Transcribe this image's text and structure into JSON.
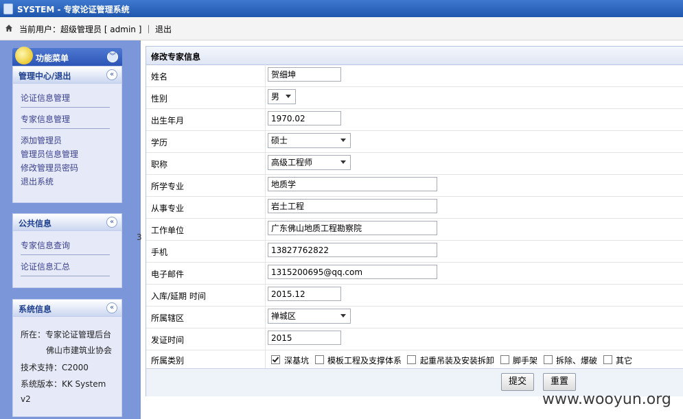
{
  "app": {
    "title": "SYSTEM - 专家论证管理系统"
  },
  "userbar": {
    "text": "当前用户：超级管理员 [ admin ] ｜ 退出"
  },
  "sidebar": {
    "menu_title": "功能菜单",
    "panel1": {
      "title": "管理中心/退出",
      "items": [
        "论证信息管理",
        "专家信息管理",
        "添加管理员",
        "管理员信息管理",
        "修改管理员密码",
        "退出系统"
      ]
    },
    "panel2": {
      "title": "公共信息",
      "items": [
        "专家信息查询",
        "论证信息汇总"
      ]
    },
    "panel3": {
      "title": "系统信息",
      "lines": [
        "所在：专家论证管理后台",
        "佛山市建筑业协会",
        "技术支持：C2000",
        "系统版本：KK System",
        "v2"
      ]
    }
  },
  "stray_char": "3",
  "form": {
    "title": "修改专家信息",
    "labels": [
      "姓名",
      "性别",
      "出生年月",
      "学历",
      "职称",
      "所学专业",
      "从事专业",
      "工作单位",
      "手机",
      "电子邮件",
      "入库/延期 时间",
      "所属辖区",
      "发证时间",
      "所属类别"
    ],
    "values": {
      "name": "贺细坤",
      "gender": "男",
      "birth": "1970.02",
      "education": "硕士",
      "title": "高级工程师",
      "major": "地质学",
      "profession": "岩土工程",
      "company": "广东佛山地质工程勘察院",
      "phone": "13827762822",
      "email": "1315200695@qq.com",
      "entry": "2015.12",
      "district": "禅城区",
      "cert_time": "2015"
    },
    "categories": [
      {
        "label": "深基坑",
        "checked": true
      },
      {
        "label": "模板工程及支撑体系",
        "checked": false
      },
      {
        "label": "起重吊装及安装拆卸",
        "checked": false
      },
      {
        "label": "脚手架",
        "checked": false
      },
      {
        "label": "拆除、爆破",
        "checked": false
      },
      {
        "label": "其它",
        "checked": false
      }
    ],
    "submit": "提交",
    "reset": "重置"
  },
  "watermark": "www.wooyun.org"
}
